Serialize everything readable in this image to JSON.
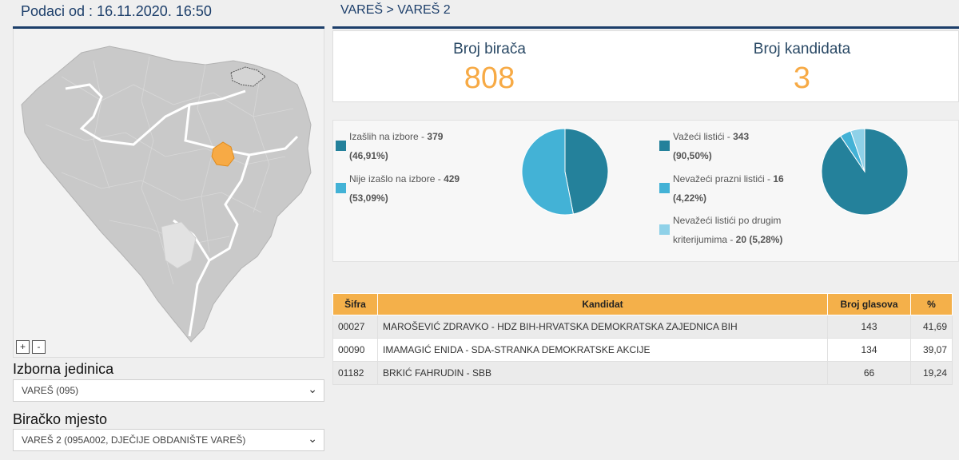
{
  "header": {
    "date_label": "Podaci od : 16.11.2020. 16:50"
  },
  "breadcrumb": "VAREŠ > VAREŠ 2",
  "stats": {
    "voters_label": "Broj birača",
    "voters_value": "808",
    "candidates_label": "Broj kandidata",
    "candidates_value": "3"
  },
  "turnout": {
    "items": [
      {
        "label": "Izašlih na izbore - ",
        "count": "379",
        "pct": "(46,91%)",
        "color": "#24819b",
        "value": 46.91
      },
      {
        "label": "Nije izašlo na izbore - ",
        "count": "429",
        "pct": "(53,09%)",
        "color": "#43b2d6",
        "value": 53.09
      }
    ]
  },
  "ballots": {
    "items": [
      {
        "label": "Važeći listići - ",
        "count": "343",
        "pct": "(90,50%)",
        "color": "#24819b",
        "value": 90.5
      },
      {
        "label": "Nevažeći prazni listići - ",
        "count": "16",
        "pct": "(4,22%)",
        "color": "#43b2d6",
        "value": 4.22
      },
      {
        "label_1": "Nevažeći listići po drugim",
        "label_2": "kriterijumima - ",
        "count": "20",
        "pct": "(5,28%)",
        "color": "#8fd1e8",
        "value": 5.28
      }
    ]
  },
  "table": {
    "headers": [
      "Šifra",
      "Kandidat",
      "Broj glasova",
      "%"
    ],
    "rows": [
      {
        "code": "00027",
        "name": "MAROŠEVIĆ ZDRAVKO - HDZ BIH-HRVATSKA DEMOKRATSKA ZAJEDNICA BIH",
        "votes": "143",
        "pct": "41,69"
      },
      {
        "code": "00090",
        "name": "IMAMAGIĆ ENIDA - SDA-STRANKA DEMOKRATSKE AKCIJE",
        "votes": "134",
        "pct": "39,07"
      },
      {
        "code": "01182",
        "name": "BRKIĆ FAHRUDIN - SBB",
        "votes": "66",
        "pct": "19,24"
      }
    ]
  },
  "map": {
    "zoom_in": "+",
    "zoom_out": "-",
    "highlight_color": "#f7aa45"
  },
  "filters": {
    "unit_label": "Izborna jedinica",
    "unit_value": "VAREŠ (095)",
    "station_label": "Biračko mjesto",
    "station_value": "VAREŠ 2 (095A002, DJEČIJE OBDANIŠTE VAREŠ)"
  }
}
